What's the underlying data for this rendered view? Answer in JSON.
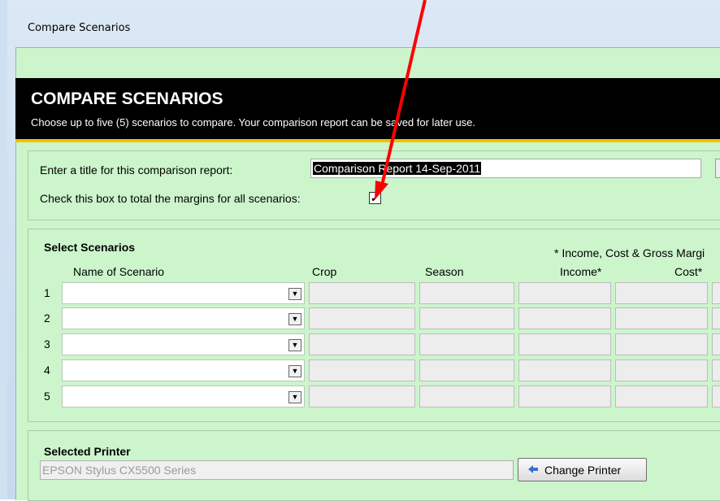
{
  "window": {
    "title": "Compare Scenarios"
  },
  "header": {
    "title": "COMPARE SCENARIOS",
    "subtitle": "Choose up to five (5) scenarios to compare. Your comparison report can be saved for later use."
  },
  "report": {
    "title_label": "Enter a title for this comparison report:",
    "title_value": "Comparison Report 14-Sep-2011",
    "total_label": "Check this box to total the margins for all scenarios:",
    "total_checked": true
  },
  "scenarios": {
    "section_title": "Select Scenarios",
    "note": "* Income, Cost & Gross Margi",
    "columns": {
      "name": "Name of Scenario",
      "crop": "Crop",
      "season": "Season",
      "income": "Income*",
      "cost": "Cost*"
    },
    "rows": [
      {
        "number": "1",
        "name": "",
        "crop": "",
        "season": "",
        "income": "",
        "cost": ""
      },
      {
        "number": "2",
        "name": "",
        "crop": "",
        "season": "",
        "income": "",
        "cost": ""
      },
      {
        "number": "3",
        "name": "",
        "crop": "",
        "season": "",
        "income": "",
        "cost": ""
      },
      {
        "number": "4",
        "name": "",
        "crop": "",
        "season": "",
        "income": "",
        "cost": ""
      },
      {
        "number": "5",
        "name": "",
        "crop": "",
        "season": "",
        "income": "",
        "cost": ""
      }
    ]
  },
  "printer": {
    "section_title": "Selected Printer",
    "value": "EPSON Stylus CX5500 Series",
    "change_button": "Change Printer"
  },
  "colors": {
    "background": "#ccf5cc",
    "header": "#000000",
    "accent_rule": "#f0c000",
    "annotation_arrow": "#ff0000"
  }
}
